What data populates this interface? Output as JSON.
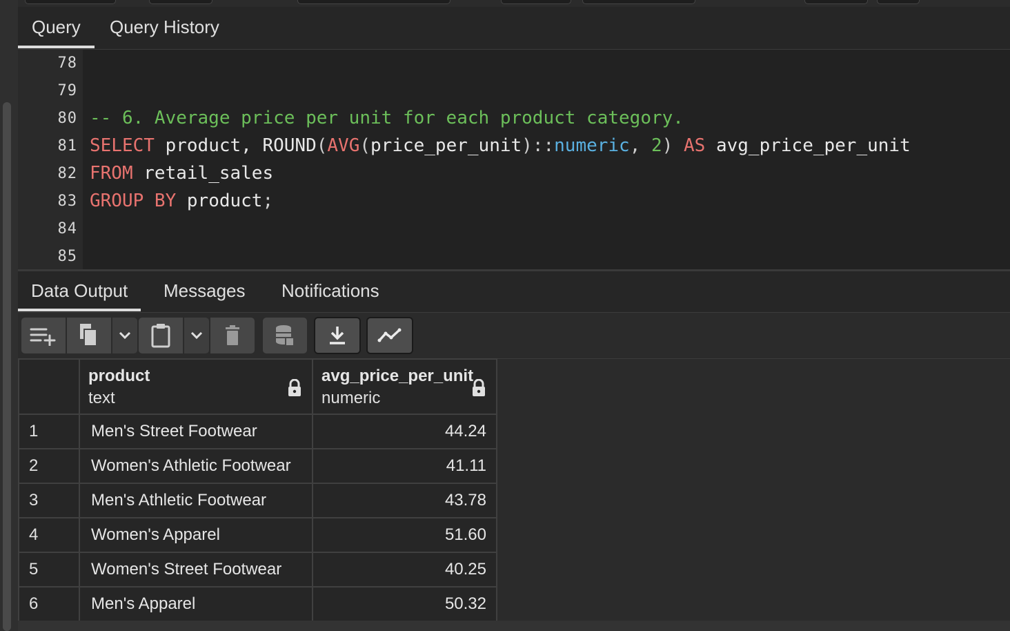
{
  "query_tabs": [
    {
      "label": "Query",
      "active": true
    },
    {
      "label": "Query History",
      "active": false
    }
  ],
  "editor": {
    "lines": [
      {
        "number": "78"
      },
      {
        "number": "79"
      },
      {
        "number": "80",
        "comment": "-- 6. Average price per unit for each product category."
      },
      {
        "number": "81",
        "tokens": {
          "k1": "SELECT",
          "t1": " product, ROUND",
          "p1": "(",
          "k2": "AVG",
          "p2": "(",
          "t2": "price_per_unit",
          "p3": ")::",
          "ty": "numeric",
          "p4": ", ",
          "n": "2",
          "p5": ") ",
          "k3": "AS",
          "t3": " avg_price_per_unit"
        }
      },
      {
        "number": "82",
        "tokens": {
          "k1": "FROM",
          "t1": " retail_sales"
        }
      },
      {
        "number": "83",
        "tokens": {
          "k1": "GROUP BY",
          "t1": " product",
          "p1": ";"
        }
      },
      {
        "number": "84"
      },
      {
        "number": "85"
      }
    ]
  },
  "result_tabs": [
    {
      "label": "Data Output",
      "active": true
    },
    {
      "label": "Messages",
      "active": false
    },
    {
      "label": "Notifications",
      "active": false
    }
  ],
  "toolbar_icons": [
    "add-row-icon",
    "copy-icon",
    "chevron-down-icon",
    "paste-icon",
    "chevron-down-icon",
    "delete-icon",
    "save-data-icon",
    "download-icon",
    "graph-icon"
  ],
  "table": {
    "columns": [
      {
        "name": "product",
        "type": "text"
      },
      {
        "name": "avg_price_per_unit",
        "type": "numeric"
      }
    ],
    "rows": [
      {
        "n": "1",
        "product": "Men's Street Footwear",
        "avg": "44.24"
      },
      {
        "n": "2",
        "product": "Women's Athletic Footwear",
        "avg": "41.11"
      },
      {
        "n": "3",
        "product": "Men's Athletic Footwear",
        "avg": "43.78"
      },
      {
        "n": "4",
        "product": "Women's Apparel",
        "avg": "51.60"
      },
      {
        "n": "5",
        "product": "Women's Street Footwear",
        "avg": "40.25"
      },
      {
        "n": "6",
        "product": "Men's Apparel",
        "avg": "50.32"
      }
    ]
  },
  "colors": {
    "keyword": "#e8736f",
    "comment": "#6cbf5a",
    "type": "#5ab0e0",
    "background": "#222222"
  }
}
